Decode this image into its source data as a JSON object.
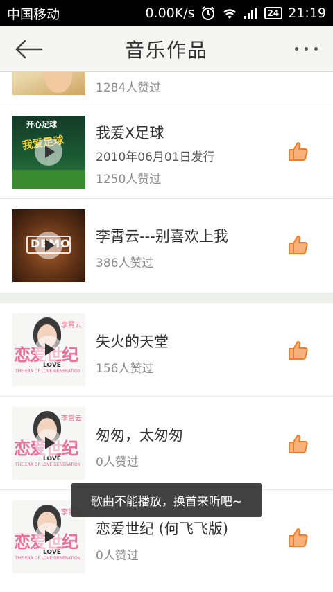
{
  "status_bar": {
    "carrier": "中国移动",
    "net_speed": "0.00K/s",
    "battery": "24",
    "time": "21:19"
  },
  "header": {
    "title": "音乐作品"
  },
  "songs": [
    {
      "title": "",
      "release": "",
      "likes": "1284人赞过"
    },
    {
      "title": "我爱X足球",
      "release": "2010年06月01日发行",
      "likes": "1250人赞过"
    },
    {
      "title": "李霄云---别喜欢上我",
      "release": "",
      "likes": "386人赞过"
    },
    {
      "title": "失火的天堂",
      "release": "",
      "likes": "156人赞过"
    },
    {
      "title": "匆匆，太匆匆",
      "release": "",
      "likes": "0人赞过"
    },
    {
      "title": "恋爱世纪 (何飞飞版)",
      "release": "",
      "likes": "0人赞过"
    }
  ],
  "covers": {
    "football_top": "开心足球",
    "football_mid": "我爱足球",
    "demo": "DEMO",
    "love_big": "恋爱世纪",
    "love_artist": "李霄云",
    "love_en": "THE ERA OF LOVE GENERATION",
    "love_sub": "LOVE"
  },
  "toast": "歌曲不能播放，换首来听吧~",
  "colors": {
    "accent": "#f07c2a",
    "like_fill": "#f6b27a"
  }
}
